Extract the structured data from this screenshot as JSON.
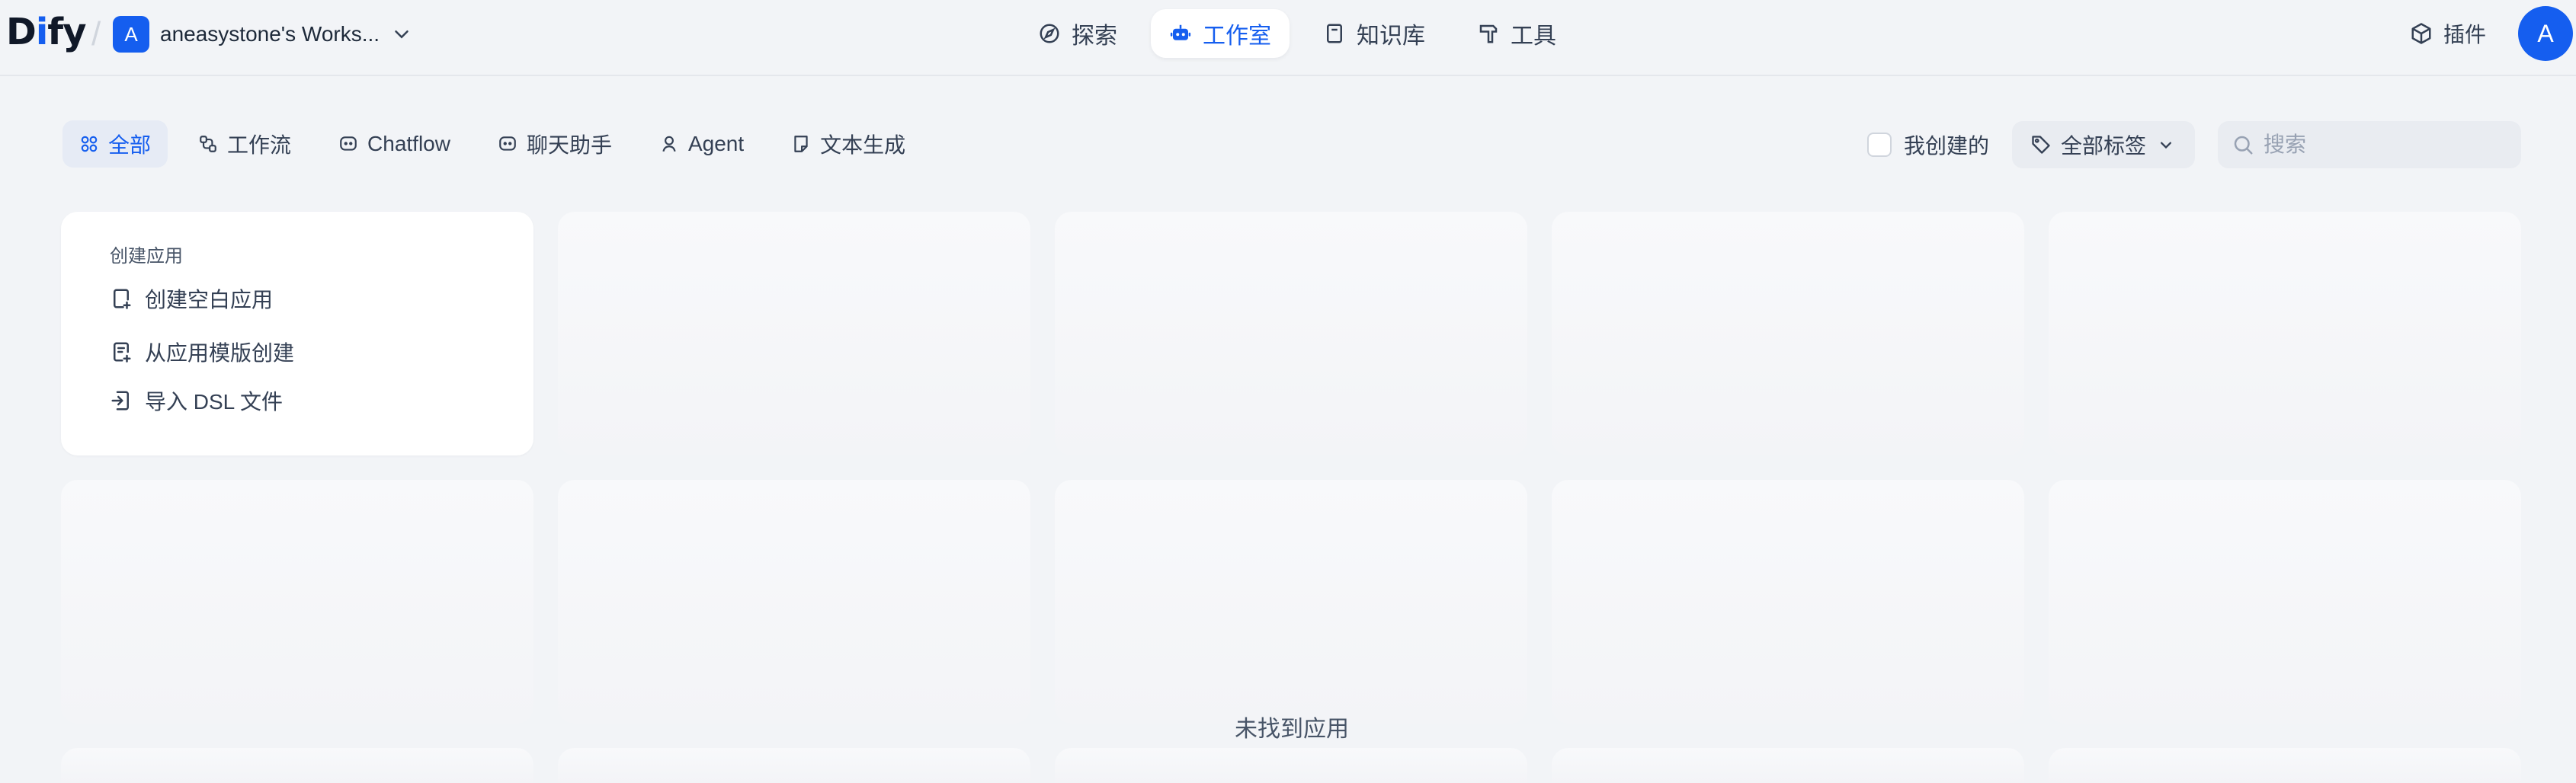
{
  "logo": {
    "d": "D",
    "i": "i",
    "f": "f",
    "y": "y"
  },
  "workspace": {
    "initial": "A",
    "name": "aneasystone's Works..."
  },
  "nav": [
    {
      "label": "探索",
      "icon": "compass-icon"
    },
    {
      "label": "工作室",
      "icon": "robot-icon",
      "active": true
    },
    {
      "label": "知识库",
      "icon": "book-icon"
    },
    {
      "label": "工具",
      "icon": "hammer-icon"
    }
  ],
  "plugins": {
    "label": "插件",
    "icon": "cube-icon"
  },
  "user": {
    "initial": "A"
  },
  "tabs": [
    {
      "label": "全部",
      "icon": "grid-icon",
      "active": true
    },
    {
      "label": "工作流",
      "icon": "workflow-icon"
    },
    {
      "label": "Chatflow",
      "icon": "chat-bubble-icon"
    },
    {
      "label": "聊天助手",
      "icon": "chat-bubble-icon"
    },
    {
      "label": "Agent",
      "icon": "agent-icon"
    },
    {
      "label": "文本生成",
      "icon": "document-icon"
    }
  ],
  "filters": {
    "mine_label": "我创建的",
    "tags_label": "全部标签",
    "search_placeholder": "搜索"
  },
  "create": {
    "title": "创建应用",
    "items": [
      {
        "label": "创建空白应用",
        "icon": "file-plus-icon"
      },
      {
        "label": "从应用模版创建",
        "icon": "template-icon"
      },
      {
        "label": "导入 DSL 文件",
        "icon": "import-icon"
      }
    ]
  },
  "empty_message": "未找到应用",
  "colors": {
    "accent": "#155eef",
    "background": "#f2f4f7"
  }
}
